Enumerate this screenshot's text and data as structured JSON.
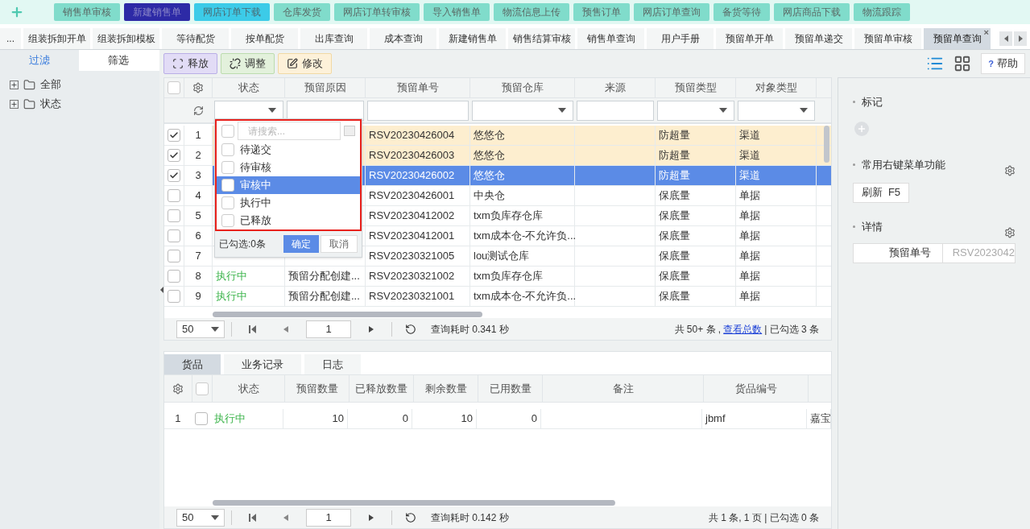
{
  "top_nav": {
    "buttons": [
      {
        "label": "销售单审核",
        "kind": "normal"
      },
      {
        "label": "新建销售单",
        "kind": "active"
      },
      {
        "label": "网店订单下载",
        "kind": "hover"
      },
      {
        "label": "仓库发货",
        "kind": "normal"
      },
      {
        "label": "网店订单转审核",
        "kind": "normal"
      },
      {
        "label": "导入销售单",
        "kind": "normal"
      },
      {
        "label": "物流信息上传",
        "kind": "normal"
      },
      {
        "label": "预售订单",
        "kind": "normal"
      },
      {
        "label": "网店订单查询",
        "kind": "normal"
      },
      {
        "label": "备货等待",
        "kind": "normal"
      },
      {
        "label": "网店商品下载",
        "kind": "normal"
      },
      {
        "label": "物流跟踪",
        "kind": "normal"
      }
    ]
  },
  "tabs": [
    {
      "label": "...",
      "selected": false
    },
    {
      "label": "组装拆卸开单",
      "selected": false
    },
    {
      "label": "组装拆卸模板",
      "selected": false
    },
    {
      "label": "等待配货",
      "selected": false
    },
    {
      "label": "按单配货",
      "selected": false
    },
    {
      "label": "出库查询",
      "selected": false
    },
    {
      "label": "成本查询",
      "selected": false
    },
    {
      "label": "新建销售单",
      "selected": false
    },
    {
      "label": "销售结算审核",
      "selected": false
    },
    {
      "label": "销售单查询",
      "selected": false
    },
    {
      "label": "用户手册",
      "selected": false
    },
    {
      "label": "预留单开单",
      "selected": false
    },
    {
      "label": "预留单递交",
      "selected": false
    },
    {
      "label": "预留单审核",
      "selected": false
    },
    {
      "label": "预留单查询",
      "selected": true
    }
  ],
  "tab_close": "×",
  "left_panel": {
    "tabs": [
      {
        "label": "过滤",
        "selected": true
      },
      {
        "label": "筛选",
        "selected": false
      }
    ],
    "tree": [
      {
        "label": "全部",
        "expanded": false
      },
      {
        "label": "状态",
        "expanded": false
      }
    ]
  },
  "toolbar": {
    "actions": [
      {
        "label": "释放",
        "kind": "release"
      },
      {
        "label": "调整",
        "kind": "adjust"
      },
      {
        "label": "修改",
        "kind": "edit"
      }
    ],
    "views": [
      {
        "kind": "list",
        "selected": true
      },
      {
        "kind": "grid",
        "selected": false
      }
    ],
    "help": {
      "icon": "?",
      "label": "帮助"
    }
  },
  "grid": {
    "all_checked": false,
    "columns": [
      {
        "label": "状态",
        "kind": "select"
      },
      {
        "label": "预留原因",
        "kind": "text"
      },
      {
        "label": "预留单号",
        "kind": "text"
      },
      {
        "label": "预留仓库",
        "kind": "select"
      },
      {
        "label": "来源",
        "kind": "text"
      },
      {
        "label": "预留类型",
        "kind": "select"
      },
      {
        "label": "对象类型",
        "kind": "select"
      }
    ],
    "rows": [
      {
        "index": "1",
        "checked": true,
        "selected": false,
        "order": "RSV20230426004",
        "warehouse": "悠悠仓",
        "type": "防超量",
        "target": "渠道"
      },
      {
        "index": "2",
        "checked": true,
        "selected": false,
        "order": "RSV20230426003",
        "warehouse": "悠悠仓",
        "type": "防超量",
        "target": "渠道"
      },
      {
        "index": "3",
        "checked": true,
        "selected": true,
        "order": "RSV20230426002",
        "warehouse": "悠悠仓",
        "type": "防超量",
        "target": "渠道"
      },
      {
        "index": "4",
        "checked": false,
        "selected": false,
        "order": "RSV20230426001",
        "warehouse": "中央仓",
        "type": "保底量",
        "target": "单据"
      },
      {
        "index": "5",
        "checked": false,
        "selected": false,
        "order": "RSV20230412002",
        "warehouse": "txm负库存仓库",
        "type": "保底量",
        "target": "单据"
      },
      {
        "index": "6",
        "checked": false,
        "selected": false,
        "order": "RSV20230412001",
        "warehouse": "txm成本仓-不允许负...",
        "type": "保底量",
        "target": "单据"
      },
      {
        "index": "7",
        "checked": false,
        "selected": false,
        "order": "RSV20230321005",
        "warehouse": "lou测试仓库",
        "type": "保底量",
        "target": "单据"
      },
      {
        "index": "8",
        "checked": false,
        "selected": false,
        "status": "执行中",
        "reason": "预留分配创建...",
        "order": "RSV20230321002",
        "warehouse": "txm负库存仓库",
        "type": "保底量",
        "target": "单据"
      },
      {
        "index": "9",
        "checked": false,
        "selected": false,
        "status": "执行中",
        "reason": "预留分配创建...",
        "order": "RSV20230321001",
        "warehouse": "txm成本仓-不允许负...",
        "type": "保底量",
        "target": "单据"
      }
    ],
    "pager": {
      "page_size": "50",
      "page": "1",
      "time": "查询耗时 0.341 秒",
      "summary": "共 50+ 条 ,",
      "link": "查看总数",
      "selected_count": "| 已勾选 3 条"
    }
  },
  "status_dropdown": {
    "all_checked": false,
    "search_placeholder": "请搜索...",
    "options": [
      {
        "label": "待递交",
        "checked": false,
        "selected": false
      },
      {
        "label": "待审核",
        "checked": false,
        "selected": false
      },
      {
        "label": "审核中",
        "checked": false,
        "selected": true
      },
      {
        "label": "执行中",
        "checked": false,
        "selected": false
      },
      {
        "label": "已释放",
        "checked": false,
        "selected": false
      }
    ],
    "count": "已勾选:0条",
    "confirm": "确定",
    "cancel": "取消"
  },
  "detail": {
    "tabs": [
      {
        "label": "货品",
        "selected": true
      },
      {
        "label": "业务记录",
        "selected": false
      },
      {
        "label": "日志",
        "selected": false
      }
    ],
    "all_checked": false,
    "columns": [
      "状态",
      "预留数量",
      "已释放数量",
      "剩余数量",
      "已用数量",
      "备注",
      "货品编号"
    ],
    "rows": [
      {
        "index": "1",
        "checked": false,
        "cells": [
          "执行中",
          "10",
          "0",
          "10",
          "0",
          "",
          "jbmf",
          "嘉宝"
        ]
      }
    ],
    "pager": {
      "page_size": "50",
      "page": "1",
      "time": "查询耗时 0.142 秒",
      "summary": "共 1 条, 1 页 | 已勾选 0 条"
    }
  },
  "right_panel": {
    "mark_title": "标记",
    "menu_title": "常用右键菜单功能",
    "menu_button": "刷新  F5",
    "detail_title": "详情",
    "detail_field": {
      "label": "预留单号",
      "value": "RSV2023042"
    }
  }
}
